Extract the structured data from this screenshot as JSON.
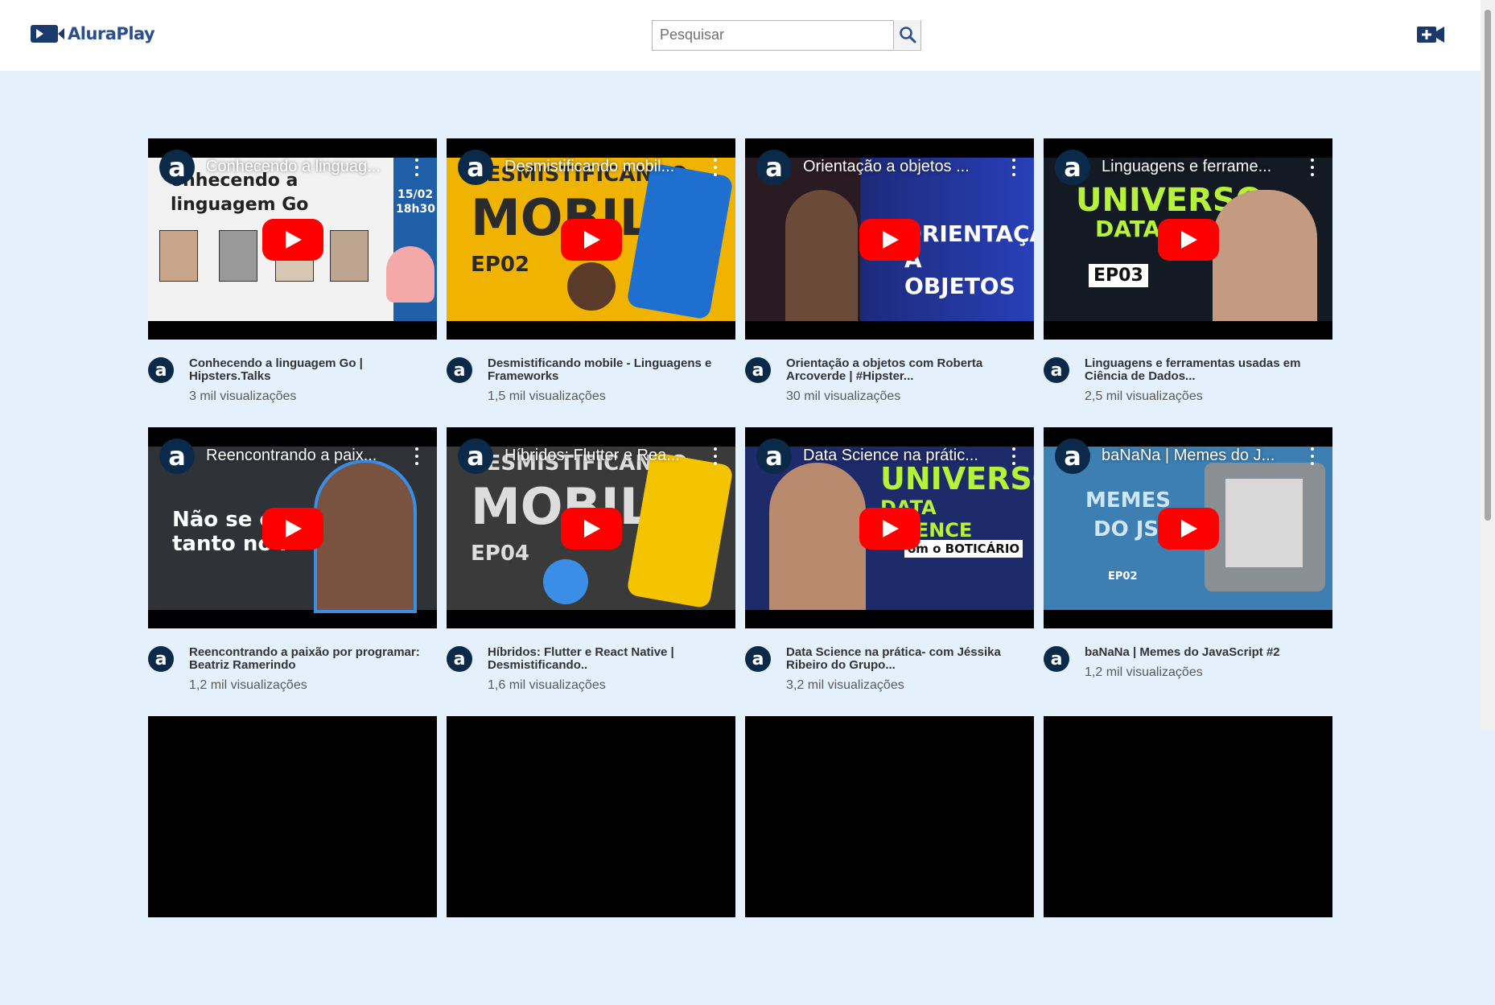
{
  "header": {
    "logo_text": "AluraPlay",
    "search_placeholder": "Pesquisar"
  },
  "icons": {
    "search": "search-icon",
    "add_video": "add-video-icon",
    "channel_avatar": "a"
  },
  "colors": {
    "background": "#e5f0fd",
    "brand": "#2a4f8f",
    "play": "#ff0000"
  },
  "videos": [
    {
      "embed_title": "Conhecendo a linguag...",
      "title": "Conhecendo a linguagem Go | Hipsters.Talks",
      "views": "3 mil visualizações",
      "art": [
        "onhecendo a",
        "linguagem Go",
        "15/02",
        "18h30"
      ]
    },
    {
      "embed_title": "Desmistificando mobil...",
      "title": "Desmistificando mobile - Linguagens e Frameworks",
      "views": "1,5 mil visualizações",
      "art": [
        "DESMISTIFICANDO",
        "MOBILE",
        "EP02"
      ]
    },
    {
      "embed_title": "Orientação a objetos ...",
      "title": "Orientação a objetos com Roberta Arcoverde | #Hipster...",
      "views": "30 mil visualizações",
      "art": [
        "ORIENTAÇÃO",
        "A OBJETOS"
      ]
    },
    {
      "embed_title": "Linguagens e ferrame...",
      "title": "Linguagens e ferramentas usadas em Ciência de Dados...",
      "views": "2,5 mil visualizações",
      "art": [
        "UNIVERSO",
        "DATA SC",
        "EP03"
      ]
    },
    {
      "embed_title": "Reencontrando a paix...",
      "title": "Reencontrando a paixão por programar: Beatriz Ramerindo",
      "views": "1,2 mil visualizações",
      "art": [
        "Não se co",
        "tanto no i"
      ]
    },
    {
      "embed_title": "Híbridos: Flutter e Rea...",
      "title": "Híbridos: Flutter e React Native | Desmistificando..",
      "views": "1,6 mil visualizações",
      "art": [
        "DESMISTIFICANDO",
        "MOBILE",
        "EP04"
      ]
    },
    {
      "embed_title": "Data Science na prátic...",
      "title": "Data Science na prática- com Jéssika Ribeiro do Grupo...",
      "views": "3,2 mil visualizações",
      "art": [
        "UNIVERSO",
        "DATA SCIENCE",
        "om o BOTICÁRIO"
      ]
    },
    {
      "embed_title": "baNaNa | Memes do J...",
      "title": "baNaNa | Memes do JavaScript #2",
      "views": "1,2 mil visualizações",
      "art": [
        "MEMES",
        "DO JS",
        "EP02"
      ]
    }
  ]
}
